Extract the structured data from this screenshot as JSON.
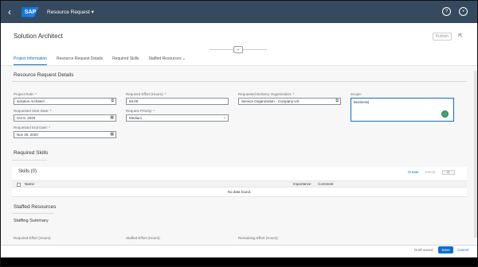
{
  "shell": {
    "logo": "SAP",
    "app_title": "Resource Request ▾",
    "back_icon": "back-icon",
    "help_icon": "help-icon",
    "user_icon": "user-icon"
  },
  "header": {
    "title": "Solution Architect",
    "publish_label": "Publish",
    "share_icon": "share-icon",
    "tabs": [
      {
        "label": "Project Information"
      },
      {
        "label": "Resource Request Details"
      },
      {
        "label": "Required Skills"
      },
      {
        "label": "Staffed Resources"
      }
    ],
    "tab_more_icon": "chevron-down-icon"
  },
  "details": {
    "section_title": "Resource Request Details",
    "project_role_label": "Project Role: *",
    "project_role_value": "Solution Architect",
    "required_effort_label": "Required Effort (Hours): *",
    "required_effort_value": "50.00",
    "delivery_org_label": "Requested Delivery Organization: *",
    "delivery_org_value": "Service Organization - Company US",
    "scope_label": "Scope:",
    "scope_value": "Business|",
    "start_date_label": "Requested Start Date: *",
    "start_date_value": "Oct 6, 2020",
    "priority_label": "Request Priority: *",
    "priority_value": "Medium",
    "end_date_label": "Requested End Date: *",
    "end_date_value": "Nov 30, 2020"
  },
  "skills": {
    "section_title": "Required Skills",
    "table_title": "Skills (0)",
    "create_label": "Create",
    "delete_label": "Delete",
    "columns": [
      "Name",
      "Importance",
      "Comment"
    ],
    "no_data": "No data found."
  },
  "staffed": {
    "section_title": "Staffed Resources",
    "summary_title": "Staffing Summary",
    "required_effort_label": "Required Effort (Hours):",
    "staffed_effort_label": "Staffed Effort (Hours):",
    "remaining_effort_label": "Remaining Effort (Hours):"
  },
  "footer": {
    "draft_status": "Draft saved",
    "save_label": "Save",
    "cancel_label": "Cancel"
  },
  "colors": {
    "shell": "#354a5f",
    "accent": "#0a6ed1",
    "status_green": "#3aa76d"
  }
}
